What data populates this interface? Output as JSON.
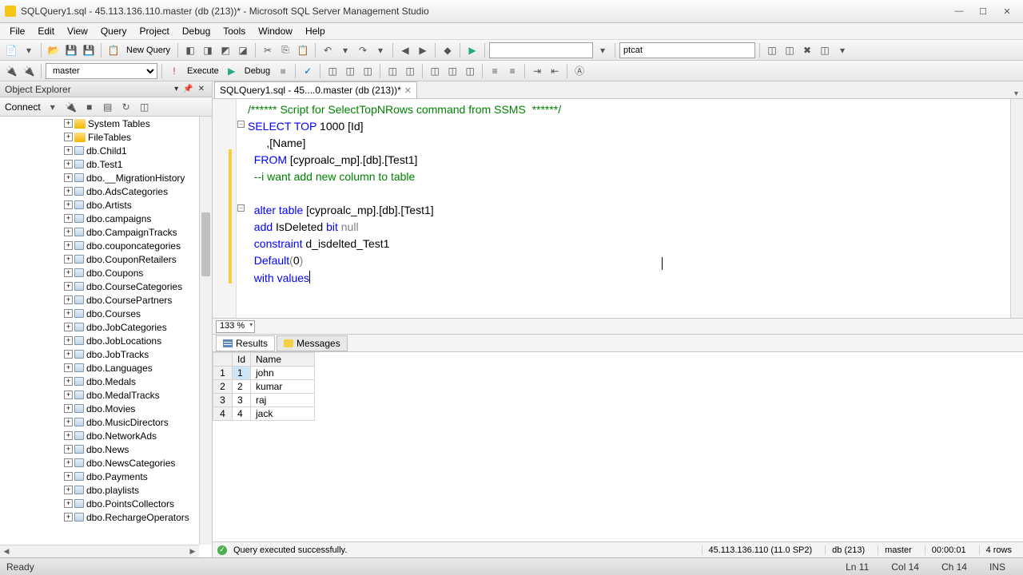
{
  "window": {
    "title": "SQLQuery1.sql - 45.113.136.110.master (db (213))* - Microsoft SQL Server Management Studio"
  },
  "menu": {
    "items": [
      "File",
      "Edit",
      "View",
      "Query",
      "Project",
      "Debug",
      "Tools",
      "Window",
      "Help"
    ]
  },
  "toolbar1": {
    "new_query": "New Query",
    "db_combo": "ptcat"
  },
  "toolbar2": {
    "db": "master",
    "execute": "Execute",
    "debug": "Debug"
  },
  "object_explorer": {
    "title": "Object Explorer",
    "connect": "Connect",
    "tree": [
      {
        "indent": 78,
        "toggle": "+",
        "icon": "folder",
        "label": "System Tables"
      },
      {
        "indent": 78,
        "toggle": "+",
        "icon": "folder",
        "label": "FileTables"
      },
      {
        "indent": 78,
        "toggle": "+",
        "icon": "table",
        "label": "db.Child1"
      },
      {
        "indent": 78,
        "toggle": "+",
        "icon": "table",
        "label": "db.Test1"
      },
      {
        "indent": 78,
        "toggle": "+",
        "icon": "table",
        "label": "dbo.__MigrationHistory"
      },
      {
        "indent": 78,
        "toggle": "+",
        "icon": "table",
        "label": "dbo.AdsCategories"
      },
      {
        "indent": 78,
        "toggle": "+",
        "icon": "table",
        "label": "dbo.Artists"
      },
      {
        "indent": 78,
        "toggle": "+",
        "icon": "table",
        "label": "dbo.campaigns"
      },
      {
        "indent": 78,
        "toggle": "+",
        "icon": "table",
        "label": "dbo.CampaignTracks"
      },
      {
        "indent": 78,
        "toggle": "+",
        "icon": "table",
        "label": "dbo.couponcategories"
      },
      {
        "indent": 78,
        "toggle": "+",
        "icon": "table",
        "label": "dbo.CouponRetailers"
      },
      {
        "indent": 78,
        "toggle": "+",
        "icon": "table",
        "label": "dbo.Coupons"
      },
      {
        "indent": 78,
        "toggle": "+",
        "icon": "table",
        "label": "dbo.CourseCategories"
      },
      {
        "indent": 78,
        "toggle": "+",
        "icon": "table",
        "label": "dbo.CoursePartners"
      },
      {
        "indent": 78,
        "toggle": "+",
        "icon": "table",
        "label": "dbo.Courses"
      },
      {
        "indent": 78,
        "toggle": "+",
        "icon": "table",
        "label": "dbo.JobCategories"
      },
      {
        "indent": 78,
        "toggle": "+",
        "icon": "table",
        "label": "dbo.JobLocations"
      },
      {
        "indent": 78,
        "toggle": "+",
        "icon": "table",
        "label": "dbo.JobTracks"
      },
      {
        "indent": 78,
        "toggle": "+",
        "icon": "table",
        "label": "dbo.Languages"
      },
      {
        "indent": 78,
        "toggle": "+",
        "icon": "table",
        "label": "dbo.Medals"
      },
      {
        "indent": 78,
        "toggle": "+",
        "icon": "table",
        "label": "dbo.MedalTracks"
      },
      {
        "indent": 78,
        "toggle": "+",
        "icon": "table",
        "label": "dbo.Movies"
      },
      {
        "indent": 78,
        "toggle": "+",
        "icon": "table",
        "label": "dbo.MusicDirectors"
      },
      {
        "indent": 78,
        "toggle": "+",
        "icon": "table",
        "label": "dbo.NetworkAds"
      },
      {
        "indent": 78,
        "toggle": "+",
        "icon": "table",
        "label": "dbo.News"
      },
      {
        "indent": 78,
        "toggle": "+",
        "icon": "table",
        "label": "dbo.NewsCategories"
      },
      {
        "indent": 78,
        "toggle": "+",
        "icon": "table",
        "label": "dbo.Payments"
      },
      {
        "indent": 78,
        "toggle": "+",
        "icon": "table",
        "label": "dbo.playlists"
      },
      {
        "indent": 78,
        "toggle": "+",
        "icon": "table",
        "label": "dbo.PointsCollectors"
      },
      {
        "indent": 78,
        "toggle": "+",
        "icon": "table",
        "label": "dbo.RechargeOperators"
      }
    ]
  },
  "doc_tab": {
    "label": "SQLQuery1.sql - 45....0.master (db (213))*"
  },
  "sql": {
    "l1a": "/****** Script for SelectTopNRows command from SSMS  ******/",
    "l2_select": "SELECT",
    "l2_top": "TOP",
    "l2_rest": " 1000 [Id]",
    "l3": "      ,[Name]",
    "l4_from": "FROM",
    "l4_rest": " [cyproalc_mp].[db].[Test1]",
    "l5": "  --i want add new column to table",
    "l6": "",
    "l7_alter": "alter",
    "l7_table": "table",
    "l7_rest": " [cyproalc_mp].[db].[Test1]",
    "l8_add": "add",
    "l8_mid": " IsDeleted ",
    "l8_bit": "bit",
    "l8_sp": " ",
    "l8_null": "null",
    "l9_con": "constraint",
    "l9_rest": " d_isdelted_Test1",
    "l10_def": "Default",
    "l10_p1": "(",
    "l10_0": "0",
    "l10_p2": ")",
    "l11_with": "with",
    "l11_sp": " ",
    "l11_val": "values"
  },
  "zoom": "133 %",
  "results_tabs": {
    "results": "Results",
    "messages": "Messages"
  },
  "results": {
    "headers": [
      "",
      "Id",
      "Name"
    ],
    "rows": [
      {
        "n": "1",
        "id": "1",
        "name": "john"
      },
      {
        "n": "2",
        "id": "2",
        "name": "kumar"
      },
      {
        "n": "3",
        "id": "3",
        "name": "raj"
      },
      {
        "n": "4",
        "id": "4",
        "name": "jack"
      }
    ]
  },
  "query_status": {
    "msg": "Query executed successfully.",
    "server": "45.113.136.110 (11.0 SP2)",
    "user": "db (213)",
    "db": "master",
    "time": "00:00:01",
    "rows": "4 rows"
  },
  "statusbar": {
    "ready": "Ready",
    "ln": "Ln 11",
    "col": "Col 14",
    "ch": "Ch 14",
    "ins": "INS"
  }
}
